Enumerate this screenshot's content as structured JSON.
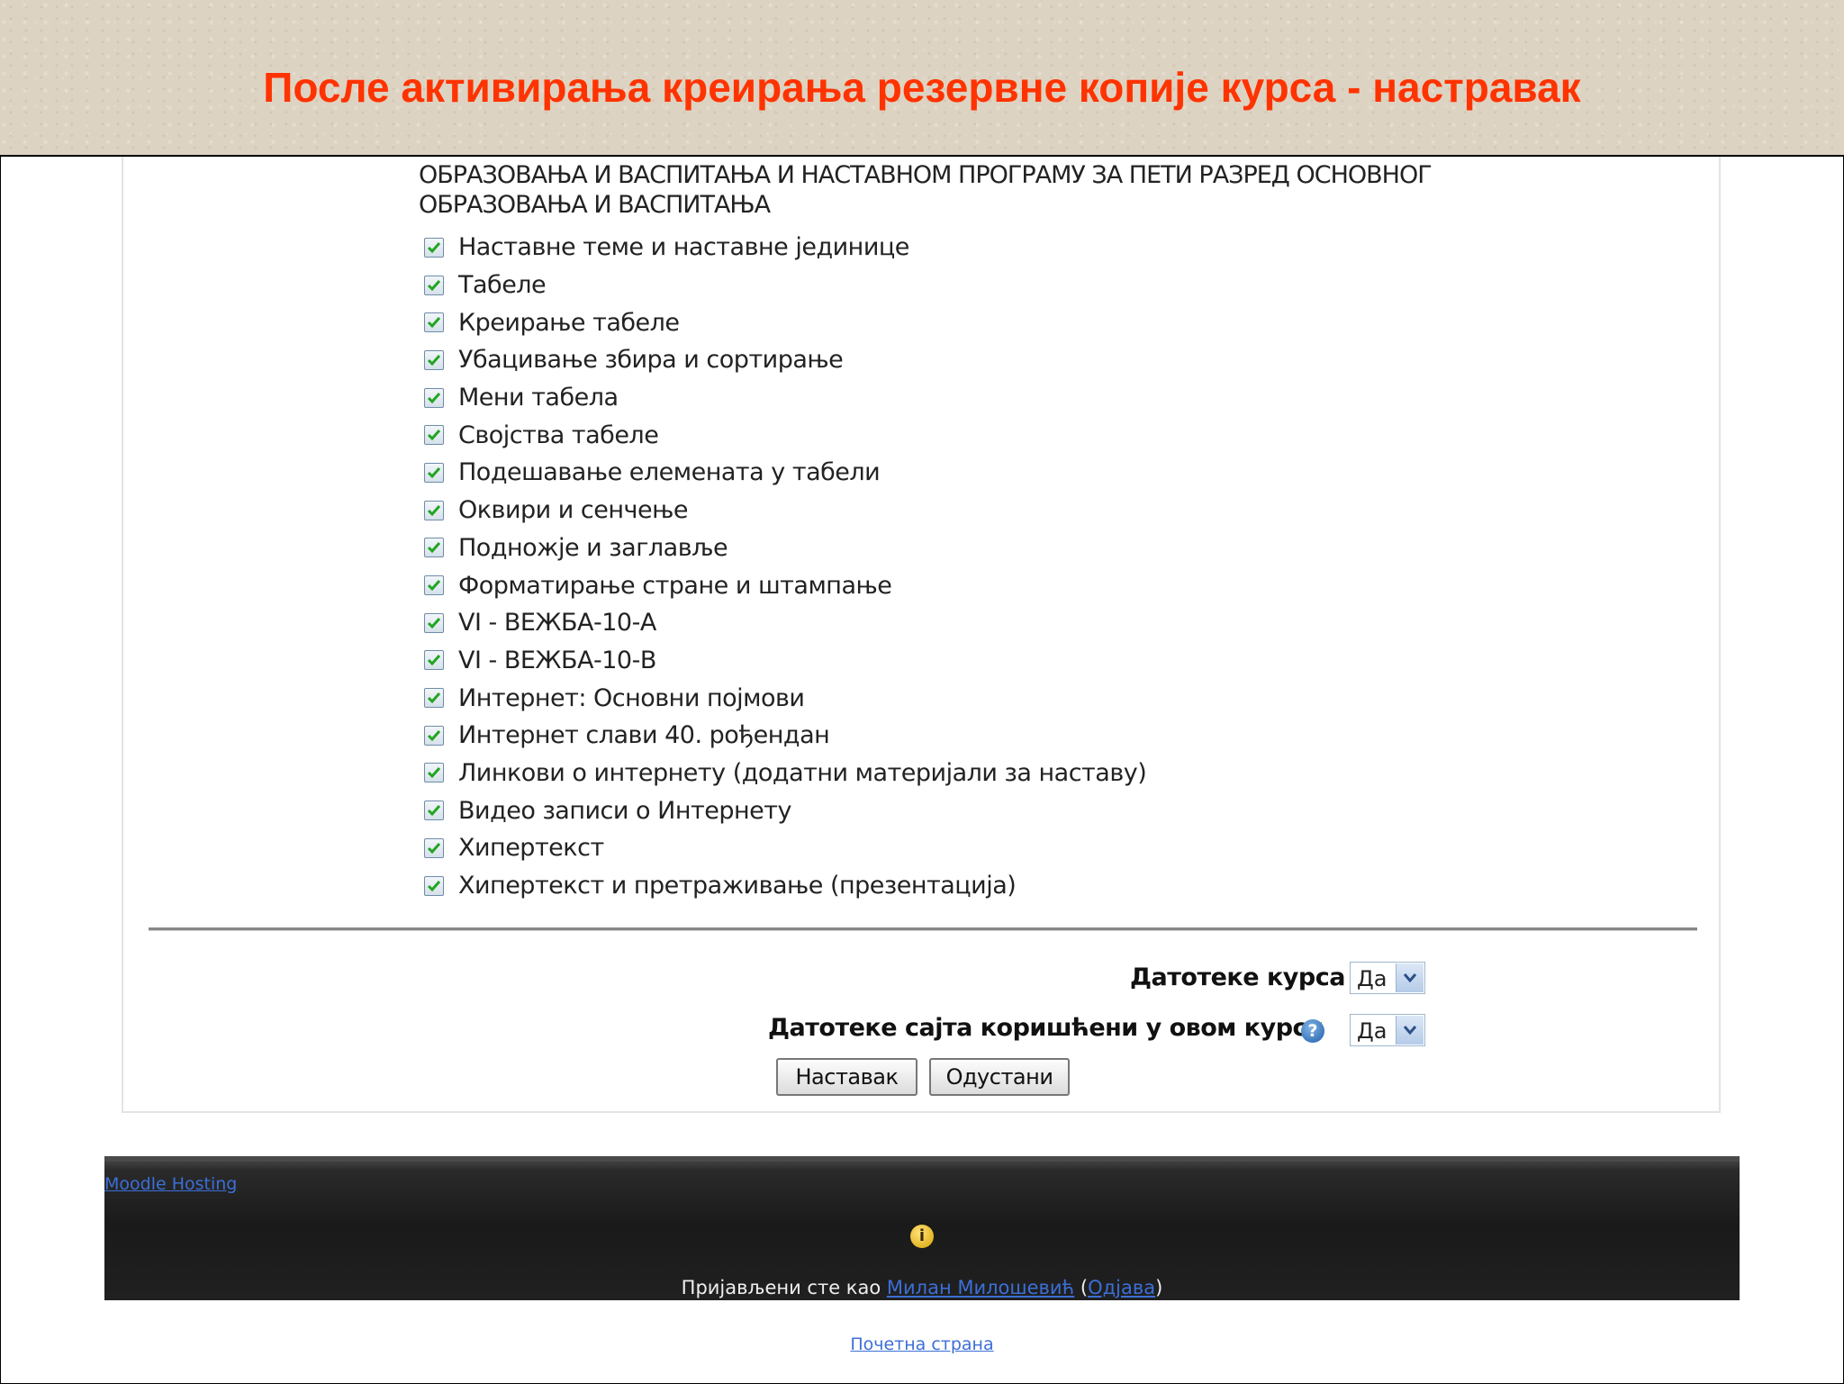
{
  "slide": {
    "title": "После активирања креирања резервне копије курса - настравак"
  },
  "form": {
    "intro_line1": "ОБРАЗОВАЊА И ВАСПИТАЊА И НАСТАВНОМ ПРОГРАМУ ЗА ПЕТИ РАЗРЕД ОСНОВНОГ",
    "intro_line2": "ОБРАЗОВАЊА И ВАСПИТАЊА",
    "items": [
      {
        "label": "Наставне теме и наставне јединице",
        "checked": true
      },
      {
        "label": "Табеле",
        "checked": true
      },
      {
        "label": "Креирање табеле",
        "checked": true
      },
      {
        "label": "Убацивање збира и сортирање",
        "checked": true
      },
      {
        "label": "Мени табела",
        "checked": true
      },
      {
        "label": "Својства табеле",
        "checked": true
      },
      {
        "label": "Подешавање елемената у табели",
        "checked": true
      },
      {
        "label": "Оквири и сенчење",
        "checked": true
      },
      {
        "label": "Подножје и заглавље",
        "checked": true
      },
      {
        "label": "Форматирање стране и штампање",
        "checked": true
      },
      {
        "label": "VI - ВЕЖБА-10-А",
        "checked": true
      },
      {
        "label": "VI - ВЕЖБА-10-В",
        "checked": true
      },
      {
        "label": "Интернет: Основни појмови",
        "checked": true
      },
      {
        "label": "Интернет слави 40. рођендан",
        "checked": true
      },
      {
        "label": "Линкови о интернету (додатни материјали за наставу)",
        "checked": true
      },
      {
        "label": "Видео записи о Интернету",
        "checked": true
      },
      {
        "label": "Хипертекст",
        "checked": true
      },
      {
        "label": "Хипертекст и претраживање (презентација)",
        "checked": true
      }
    ],
    "course_files": {
      "label": "Датотеке курса",
      "value": "Да"
    },
    "site_files": {
      "label": "Датотеке сајта коришћени у овом курсу",
      "value": "Да"
    },
    "continue_label": "Наставак",
    "cancel_label": "Одустани"
  },
  "footer": {
    "hosting_link": "Moodle Hosting",
    "logged_in_prefix": "Пријављени сте као ",
    "user_name": "Милан Милошевић",
    "open_paren": " (",
    "logout_label": "Одјава",
    "close_paren": ")",
    "home_link": "Почетна страна"
  },
  "colors": {
    "title": "#ff3300",
    "link": "#3b6fd6"
  }
}
